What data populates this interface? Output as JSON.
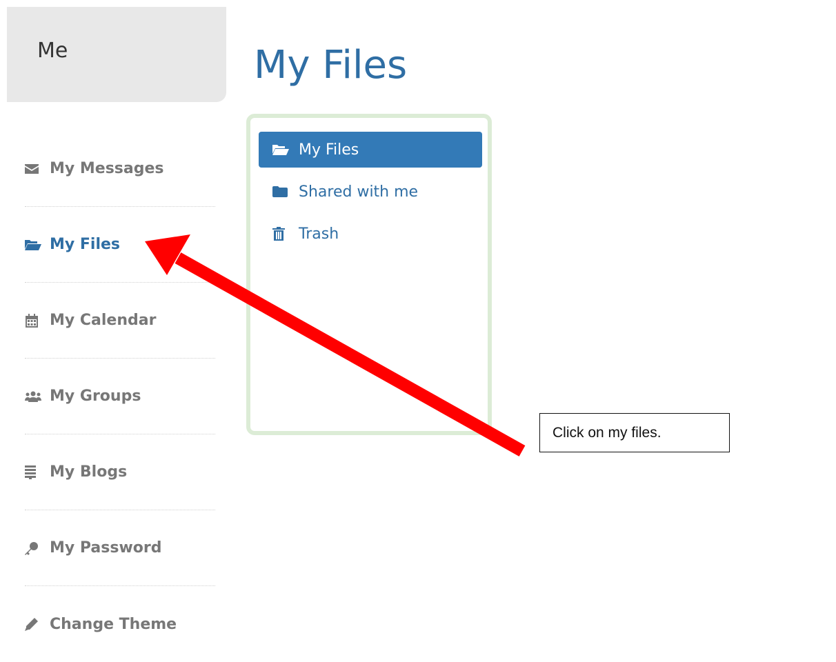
{
  "header": {
    "tab_label": "Me",
    "page_title": "My Files"
  },
  "sidebar": {
    "items": [
      {
        "label": "My Messages",
        "icon": "envelope-icon"
      },
      {
        "label": "My Files",
        "icon": "folder-open-icon",
        "active": true
      },
      {
        "label": "My Calendar",
        "icon": "calendar-icon"
      },
      {
        "label": "My Groups",
        "icon": "users-icon"
      },
      {
        "label": "My Blogs",
        "icon": "list-icon"
      },
      {
        "label": "My Password",
        "icon": "key-icon"
      },
      {
        "label": "Change Theme",
        "icon": "pencil-icon"
      }
    ]
  },
  "files_nav": {
    "items": [
      {
        "label": "My Files",
        "icon": "folder-open-icon",
        "active": true
      },
      {
        "label": "Shared with me",
        "icon": "folder-icon"
      },
      {
        "label": "Trash",
        "icon": "trash-icon"
      }
    ]
  },
  "annotation": {
    "callout_text": "Click on my files.",
    "arrow_color": "#ff0000"
  },
  "colors": {
    "accent": "#337ab7",
    "title": "#2f6ea4",
    "sidebar_text": "#777777",
    "box_border": "#dcecd6"
  }
}
